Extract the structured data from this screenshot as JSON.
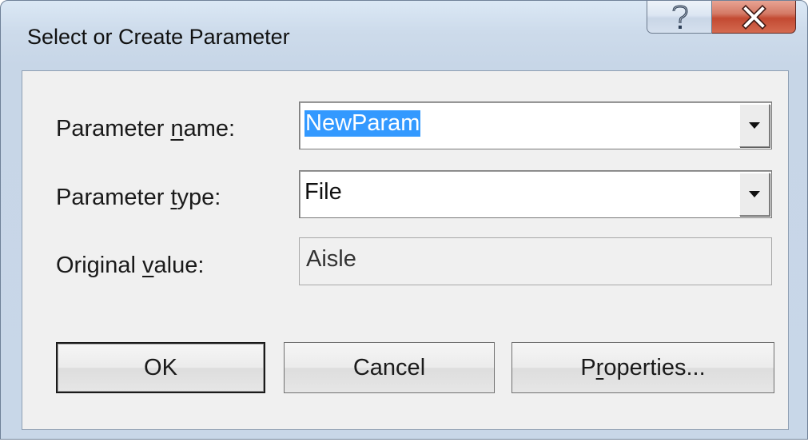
{
  "window": {
    "title": "Select or Create Parameter",
    "caption_buttons": [
      {
        "name": "help",
        "icon": "question-mark-icon"
      },
      {
        "name": "close",
        "icon": "close-x-icon"
      }
    ]
  },
  "form": {
    "parameter_name": {
      "label_pre": "Parameter ",
      "label_accel": "n",
      "label_post": "ame:",
      "value": "NewParam",
      "value_selected": true
    },
    "parameter_type": {
      "label_pre": "Parameter ",
      "label_accel": "t",
      "label_post": "ype:",
      "value": "File"
    },
    "original_value": {
      "label_pre": "Original ",
      "label_accel": "v",
      "label_post": "alue:",
      "value": "Aisle"
    }
  },
  "buttons": {
    "ok": "OK",
    "cancel": "Cancel",
    "properties_pre": "P",
    "properties_accel": "r",
    "properties_post": "operties..."
  },
  "colors": {
    "selection": "#3399ff",
    "close_button": "#c34a32",
    "title_bar": "#cddbeb"
  }
}
